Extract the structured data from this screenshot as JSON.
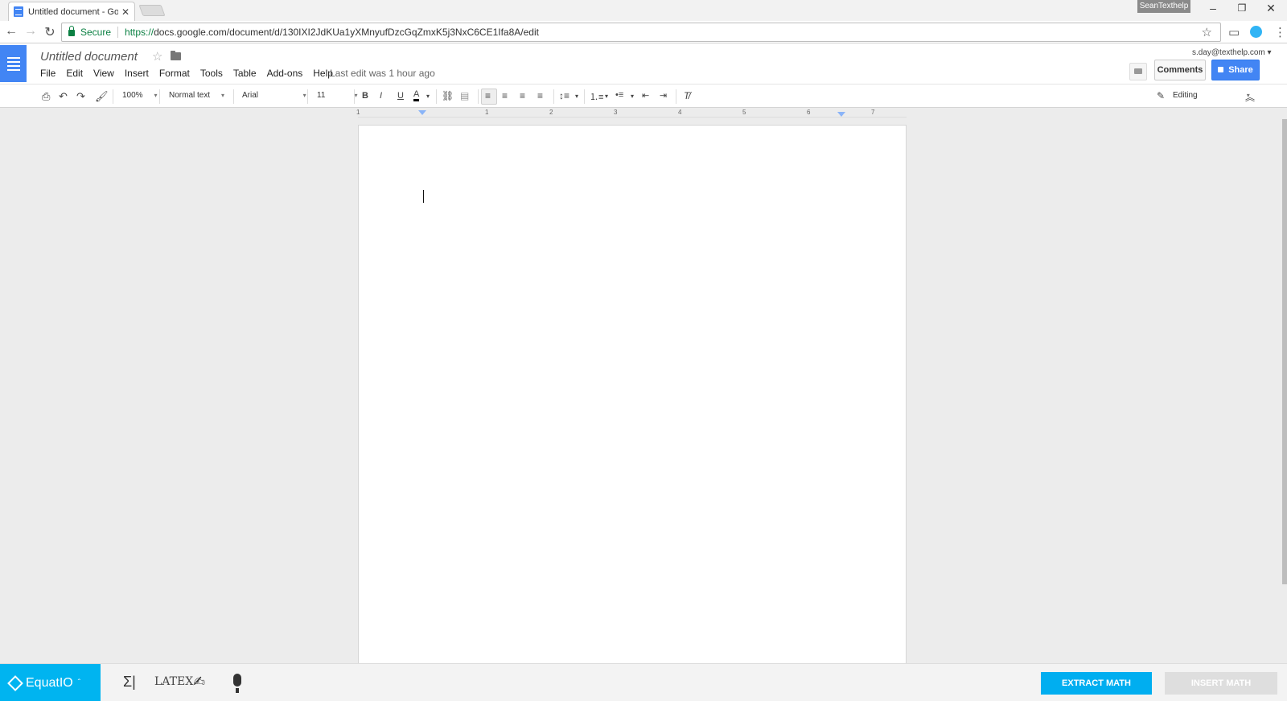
{
  "browser": {
    "tab_title": "Untitled document - Goo",
    "profile_name": "SeanTexthelp",
    "secure_label": "Secure",
    "url_scheme": "https://",
    "url_rest": "docs.google.com/document/d/130IXI2JdKUa1yXMnyufDzcGqZmxK5j3NxC6CE1Ifa8A/edit"
  },
  "docs": {
    "doc_title": "Untitled document",
    "menus": [
      "File",
      "Edit",
      "View",
      "Insert",
      "Format",
      "Tools",
      "Table",
      "Add-ons",
      "Help"
    ],
    "last_edit": "Last edit was 1 hour ago",
    "account": "s.day@texthelp.com",
    "comments_label": "Comments",
    "share_label": "Share"
  },
  "toolbar": {
    "zoom": "100%",
    "style": "Normal text",
    "font": "Arial",
    "size": "11",
    "mode": "Editing"
  },
  "ruler": {
    "labels": [
      "1",
      "1",
      "2",
      "3",
      "4",
      "5",
      "6",
      "7"
    ]
  },
  "equatio": {
    "logo_text": "EquatIO",
    "latex_label": "LATEX",
    "extract_label": "EXTRACT MATH",
    "insert_label": "INSERT MATH"
  },
  "colors": {
    "docs_blue": "#4285f4",
    "equatio_blue": "#00aef0"
  }
}
